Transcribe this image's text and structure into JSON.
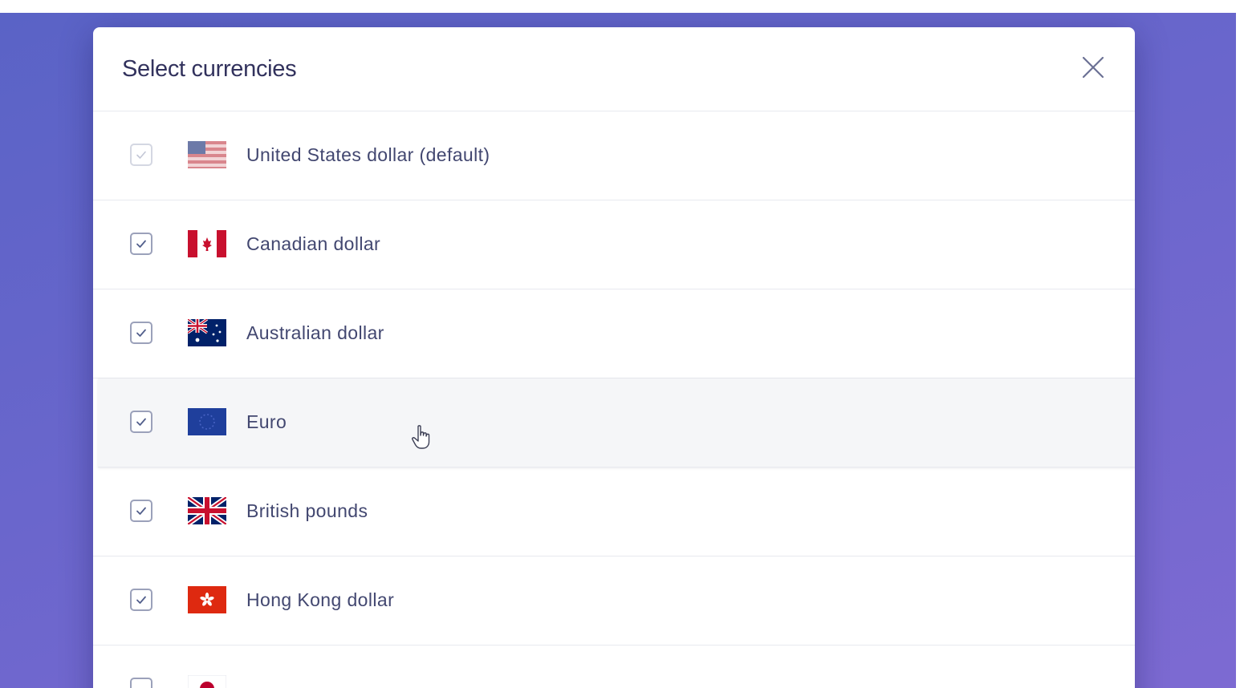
{
  "modal": {
    "title": "Select currencies"
  },
  "currencies": [
    {
      "label": "United States dollar (default)",
      "checked": true,
      "disabled": true,
      "flag": "us-flag-icon"
    },
    {
      "label": "Canadian dollar",
      "checked": true,
      "disabled": false,
      "flag": "ca-flag-icon"
    },
    {
      "label": "Australian dollar",
      "checked": true,
      "disabled": false,
      "flag": "au-flag-icon"
    },
    {
      "label": "Euro",
      "checked": true,
      "disabled": false,
      "flag": "eu-flag-icon",
      "hovered": true
    },
    {
      "label": "British pounds",
      "checked": true,
      "disabled": false,
      "flag": "gb-flag-icon"
    },
    {
      "label": "Hong Kong dollar",
      "checked": true,
      "disabled": false,
      "flag": "hk-flag-icon"
    }
  ],
  "colors": {
    "backdrop": "#6366c9",
    "text": "#424770",
    "title": "#32325d",
    "hover_row": "#f5f6f8"
  }
}
